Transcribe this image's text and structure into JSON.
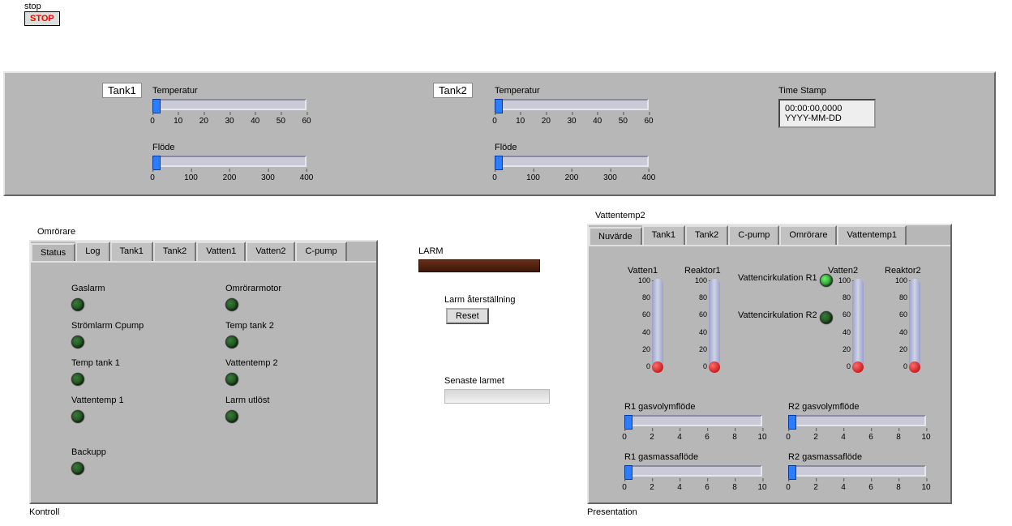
{
  "stop": {
    "label": "stop",
    "button": "STOP"
  },
  "tanks": {
    "tank1": {
      "label": "Tank1",
      "temp": {
        "label": "Temperatur",
        "ticks": [
          "0",
          "10",
          "20",
          "30",
          "40",
          "50",
          "60"
        ]
      },
      "flow": {
        "label": "Flöde",
        "ticks": [
          "0",
          "100",
          "200",
          "300",
          "400"
        ]
      }
    },
    "tank2": {
      "label": "Tank2",
      "temp": {
        "label": "Temperatur",
        "ticks": [
          "0",
          "10",
          "20",
          "30",
          "40",
          "50",
          "60"
        ]
      },
      "flow": {
        "label": "Flöde",
        "ticks": [
          "0",
          "100",
          "200",
          "300",
          "400"
        ]
      }
    }
  },
  "timestamp": {
    "label": "Time Stamp",
    "line1": "00:00:00,0000",
    "line2": "YYYY-MM-DD"
  },
  "kontroll": {
    "panel_title": "Omrörare",
    "tabs": [
      "Status",
      "Log",
      "Tank1",
      "Tank2",
      "Vatten1",
      "Vatten2",
      "C-pump"
    ],
    "active": "Status",
    "leds_left": [
      {
        "label": "Gaslarm"
      },
      {
        "label": "Strömlarm Cpump"
      },
      {
        "label": "Temp tank 1"
      },
      {
        "label": "Vattentemp 1"
      },
      {
        "label": "Backupp"
      }
    ],
    "leds_right": [
      {
        "label": "Omrörarmotor"
      },
      {
        "label": "Temp tank 2"
      },
      {
        "label": "Vattentemp 2"
      },
      {
        "label": "Larm utlöst"
      }
    ],
    "footer": "Kontroll"
  },
  "larm": {
    "title": "LARM",
    "reset_label": "Larm återställning",
    "reset_btn": "Reset",
    "latest_label": "Senaste larmet"
  },
  "presentation": {
    "panel_title": "Vattentemp2",
    "tabs": [
      "Nuvärde",
      "Tank1",
      "Tank2",
      "C-pump",
      "Omrörare",
      "Vattentemp1"
    ],
    "active": "Nuvärde",
    "thermos": [
      {
        "label": "Vatten1"
      },
      {
        "label": "Reaktor1"
      },
      {
        "label": "Vatten2"
      },
      {
        "label": "Reaktor2"
      }
    ],
    "thermo_ticks": [
      "100",
      "80",
      "60",
      "40",
      "20",
      "0"
    ],
    "circ1": "Vattencirkulation R1",
    "circ2": "Vattencirkulation R2",
    "hsliders": [
      {
        "label": "R1 gasvolymflöde"
      },
      {
        "label": "R2 gasvolymflöde"
      },
      {
        "label": "R1 gasmassaflöde"
      },
      {
        "label": "R2 gasmassaflöde"
      }
    ],
    "hslider_ticks": [
      "0",
      "2",
      "4",
      "6",
      "8",
      "10"
    ],
    "footer": "Presentation"
  }
}
